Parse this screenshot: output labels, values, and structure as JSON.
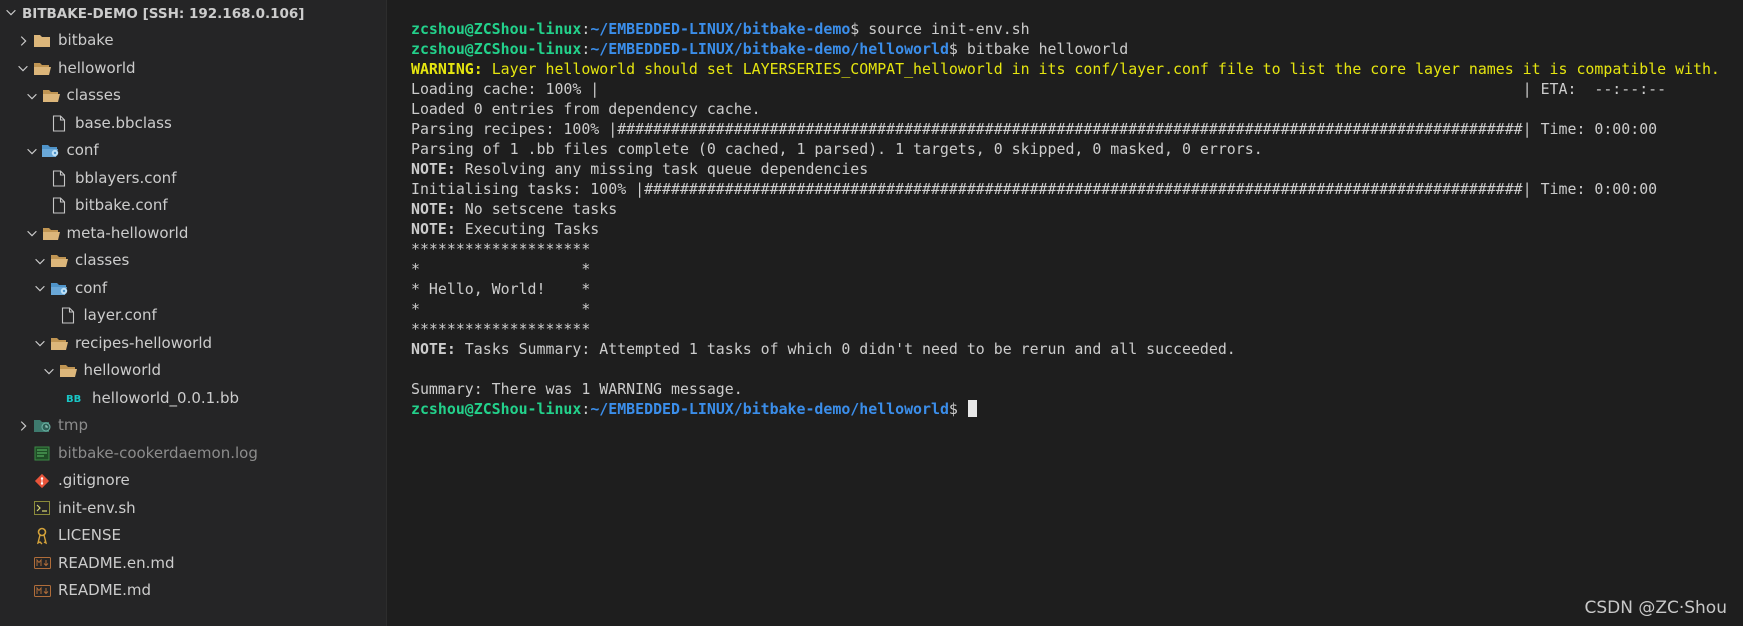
{
  "explorer": {
    "header": "BITBAKE-DEMO [SSH: 192.168.0.106]",
    "items": [
      {
        "label": "bitbake",
        "indent": 0,
        "twisty": "closed",
        "icon": "folder-icon"
      },
      {
        "label": "helloworld",
        "indent": 0,
        "twisty": "open",
        "icon": "folder-open-icon"
      },
      {
        "label": "classes",
        "indent": 1,
        "twisty": "open",
        "icon": "folder-open-icon"
      },
      {
        "label": "base.bbclass",
        "indent": 2,
        "twisty": "none",
        "icon": "file-icon"
      },
      {
        "label": "conf",
        "indent": 1,
        "twisty": "open",
        "icon": "config-folder-icon"
      },
      {
        "label": "bblayers.conf",
        "indent": 2,
        "twisty": "none",
        "icon": "file-icon"
      },
      {
        "label": "bitbake.conf",
        "indent": 2,
        "twisty": "none",
        "icon": "file-icon"
      },
      {
        "label": "meta-helloworld",
        "indent": 1,
        "twisty": "open",
        "icon": "folder-open-icon"
      },
      {
        "label": "classes",
        "indent": 2,
        "twisty": "open",
        "icon": "folder-open-icon"
      },
      {
        "label": "conf",
        "indent": 2,
        "twisty": "open",
        "icon": "config-folder-icon"
      },
      {
        "label": "layer.conf",
        "indent": 3,
        "twisty": "none",
        "icon": "file-icon"
      },
      {
        "label": "recipes-helloworld",
        "indent": 2,
        "twisty": "open",
        "icon": "folder-open-icon"
      },
      {
        "label": "helloworld",
        "indent": 3,
        "twisty": "open",
        "icon": "folder-open-icon"
      },
      {
        "label": "helloworld_0.0.1.bb",
        "indent": 4,
        "twisty": "none",
        "icon": "bitbake-file-icon"
      },
      {
        "label": "tmp",
        "indent": 0,
        "twisty": "closed",
        "icon": "temp-folder-icon",
        "dim": true
      },
      {
        "label": "bitbake-cookerdaemon.log",
        "indent": 0,
        "twisty": "none",
        "icon": "log-file-icon",
        "dim": true
      },
      {
        "label": ".gitignore",
        "indent": 0,
        "twisty": "none",
        "icon": "git-icon"
      },
      {
        "label": "init-env.sh",
        "indent": 0,
        "twisty": "none",
        "icon": "shell-icon"
      },
      {
        "label": "LICENSE",
        "indent": 0,
        "twisty": "none",
        "icon": "license-icon"
      },
      {
        "label": "README.en.md",
        "indent": 0,
        "twisty": "none",
        "icon": "markdown-icon"
      },
      {
        "label": "README.md",
        "indent": 0,
        "twisty": "none",
        "icon": "markdown-icon"
      }
    ]
  },
  "terminal": {
    "lines": [
      [
        {
          "t": "zcshou@ZCShou-linux",
          "c": "user"
        },
        {
          "t": ":",
          "c": ""
        },
        {
          "t": "~/EMBEDDED-LINUX/bitbake-demo",
          "c": "path"
        },
        {
          "t": "$ source init-env.sh",
          "c": ""
        }
      ],
      [
        {
          "t": "zcshou@ZCShou-linux",
          "c": "user"
        },
        {
          "t": ":",
          "c": ""
        },
        {
          "t": "~/EMBEDDED-LINUX/bitbake-demo/helloworld",
          "c": "path"
        },
        {
          "t": "$ bitbake helloworld",
          "c": ""
        }
      ],
      [
        {
          "t": "WARNING:",
          "c": "warn bold"
        },
        {
          "t": " Layer helloworld should set LAYERSERIES_COMPAT_helloworld in its conf/layer.conf file to list the core layer names it is compatible with.",
          "c": "warn"
        }
      ],
      [
        {
          "t": "Loading cache: 100% |                                                                                                       | ETA:  --:--:--",
          "c": ""
        }
      ],
      [
        {
          "t": "Loaded 0 entries from dependency cache.",
          "c": ""
        }
      ],
      [
        {
          "t": "Parsing recipes: 100% |#####################################################################################################| Time: 0:00:00",
          "c": ""
        }
      ],
      [
        {
          "t": "Parsing of 1 .bb files complete (0 cached, 1 parsed). 1 targets, 0 skipped, 0 masked, 0 errors.",
          "c": ""
        }
      ],
      [
        {
          "t": "NOTE:",
          "c": "bold"
        },
        {
          "t": " Resolving any missing task queue dependencies",
          "c": ""
        }
      ],
      [
        {
          "t": "Initialising tasks: 100% |##################################################################################################| Time: 0:00:00",
          "c": ""
        }
      ],
      [
        {
          "t": "NOTE:",
          "c": "bold"
        },
        {
          "t": " No setscene tasks",
          "c": ""
        }
      ],
      [
        {
          "t": "NOTE:",
          "c": "bold"
        },
        {
          "t": " Executing Tasks",
          "c": ""
        }
      ],
      [
        {
          "t": "********************",
          "c": ""
        }
      ],
      [
        {
          "t": "*                  *",
          "c": ""
        }
      ],
      [
        {
          "t": "* Hello, World!    *",
          "c": ""
        }
      ],
      [
        {
          "t": "*                  *",
          "c": ""
        }
      ],
      [
        {
          "t": "********************",
          "c": ""
        }
      ],
      [
        {
          "t": "NOTE:",
          "c": "bold"
        },
        {
          "t": " Tasks Summary: Attempted 1 tasks of which 0 didn't need to be rerun and all succeeded.",
          "c": ""
        }
      ],
      [
        {
          "t": "",
          "c": ""
        }
      ],
      [
        {
          "t": "Summary: There was 1 WARNING message.",
          "c": ""
        }
      ],
      [
        {
          "t": "zcshou@ZCShou-linux",
          "c": "user"
        },
        {
          "t": ":",
          "c": ""
        },
        {
          "t": "~/EMBEDDED-LINUX/bitbake-demo/helloworld",
          "c": "path"
        },
        {
          "t": "$ ",
          "c": ""
        },
        {
          "t": "",
          "c": "cursor"
        }
      ]
    ]
  },
  "watermark": "CSDN @ZC·Shou"
}
